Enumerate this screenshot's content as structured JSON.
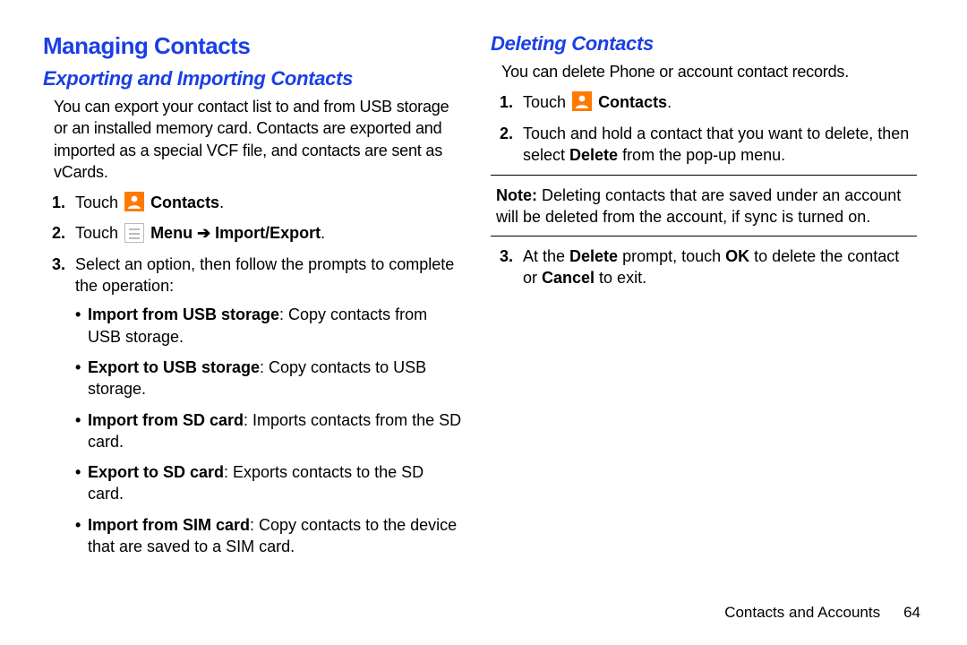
{
  "left": {
    "h1": "Managing Contacts",
    "h2": "Exporting and Importing Contacts",
    "intro": "You can export your contact list to and from USB storage or an installed memory card. Contacts are exported and imported as a special VCF file, and contacts are sent as vCards.",
    "steps": {
      "s1_num": "1.",
      "s1_pre": "Touch ",
      "s1_post": " ",
      "s1_bold": "Contacts",
      "s1_end": ".",
      "s2_num": "2.",
      "s2_pre": "Touch ",
      "s2_bold1": "Menu",
      "s2_arrow": " ➔ ",
      "s2_bold2": "Import/Export",
      "s2_end": ".",
      "s3_num": "3.",
      "s3_text": "Select an option, then follow the prompts to complete the operation:",
      "b1_bold": "Import from USB storage",
      "b1_rest": ": Copy contacts from USB storage.",
      "b2_bold": "Export to USB storage",
      "b2_rest": ": Copy contacts to USB storage.",
      "b3_bold": "Import from SD card",
      "b3_rest": ": Imports contacts from the SD card.",
      "b4_bold": "Export to SD card",
      "b4_rest": ": Exports contacts to the SD card.",
      "b5_bold": "Import from SIM card",
      "b5_rest": ": Copy contacts to the device that are saved to a SIM card."
    }
  },
  "right": {
    "h2": "Deleting Contacts",
    "intro": "You can delete Phone or account contact records.",
    "steps": {
      "s1_num": "1.",
      "s1_pre": "Touch ",
      "s1_bold": "Contacts",
      "s1_end": ".",
      "s2_num": "2.",
      "s2_a": "Touch and hold a contact that you want to delete, then select ",
      "s2_bold": "Delete",
      "s2_b": " from the pop-up menu.",
      "note_label": "Note:",
      "note_text": " Deleting contacts that are saved under an account will be deleted from the account, if sync is turned on.",
      "s3_num": "3.",
      "s3_a": "At the ",
      "s3_bold1": "Delete",
      "s3_b": " prompt, touch ",
      "s3_bold2": "OK",
      "s3_c": " to delete the contact or ",
      "s3_bold3": "Cancel",
      "s3_d": " to exit."
    }
  },
  "footer": {
    "text": "Contacts and Accounts",
    "page": "64"
  }
}
